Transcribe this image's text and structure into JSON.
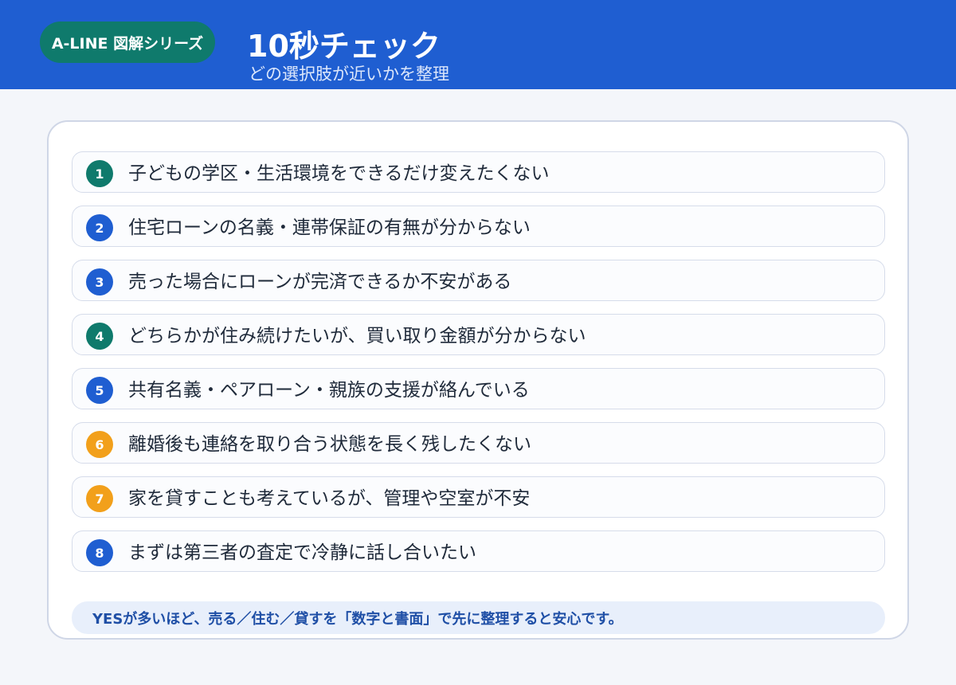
{
  "header": {
    "badge": "A-LINE 図解シリーズ",
    "title": "10秒チェック",
    "subtitle": "どの選択肢が近いかを整理"
  },
  "items": [
    {
      "num": "1",
      "text": "子どもの学区・生活環境をできるだけ変えたくない",
      "color": "#0f7a6c"
    },
    {
      "num": "2",
      "text": "住宅ローンの名義・連帯保証の有無が分からない",
      "color": "#1f5ed1"
    },
    {
      "num": "3",
      "text": "売った場合にローンが完済できるか不安がある",
      "color": "#1f5ed1"
    },
    {
      "num": "4",
      "text": "どちらかが住み続けたいが、買い取り金額が分からない",
      "color": "#0f7a6c"
    },
    {
      "num": "5",
      "text": "共有名義・ペアローン・親族の支援が絡んでいる",
      "color": "#1f5ed1"
    },
    {
      "num": "6",
      "text": "離婚後も連絡を取り合う状態を長く残したくない",
      "color": "#f2a01b"
    },
    {
      "num": "7",
      "text": "家を貸すことも考えているが、管理や空室が不安",
      "color": "#f2a01b"
    },
    {
      "num": "8",
      "text": "まずは第三者の査定で冷静に話し合いたい",
      "color": "#1f5ed1"
    }
  ],
  "note": "YESが多いほど、売る／住む／貸すを「数字と書面」で先に整理すると安心です。",
  "colors": {
    "header_bg": "#1f5ed1",
    "badge_bg": "#0f7a6c",
    "accent_green": "#0f7a6c",
    "accent_blue": "#1f5ed1",
    "accent_orange": "#f2a01b"
  }
}
